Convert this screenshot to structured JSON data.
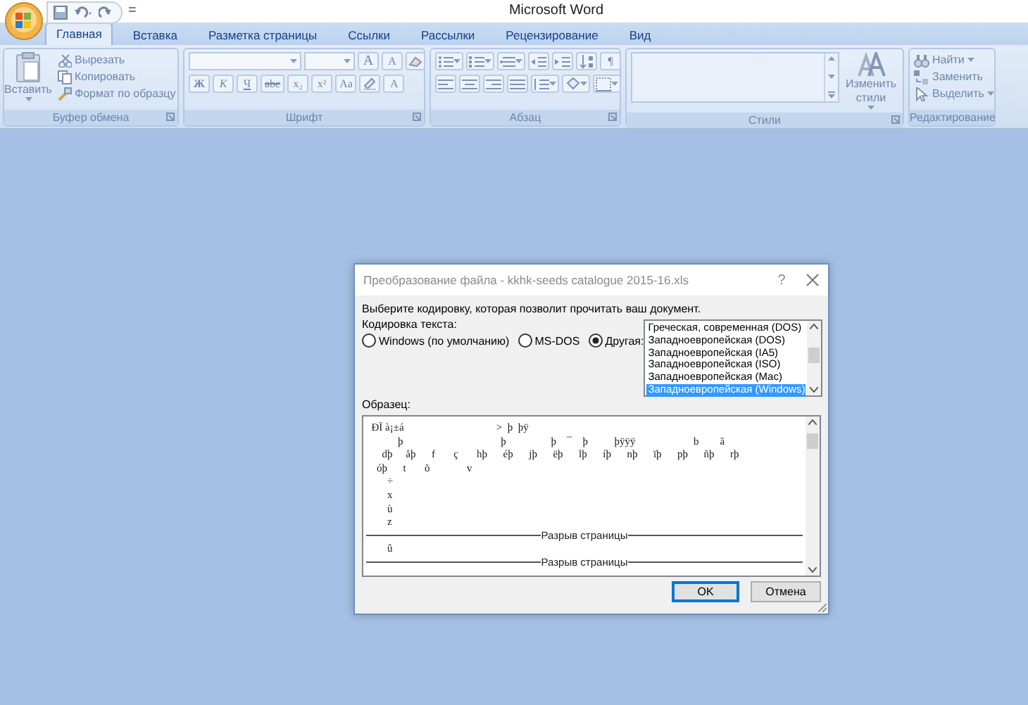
{
  "window": {
    "title": "Microsoft Word"
  },
  "quick_access": {
    "customize": "="
  },
  "tabs": [
    {
      "label": "Главная",
      "selected": true
    },
    {
      "label": "Вставка",
      "selected": false
    },
    {
      "label": "Разметка страницы",
      "selected": false
    },
    {
      "label": "Ссылки",
      "selected": false
    },
    {
      "label": "Рассылки",
      "selected": false
    },
    {
      "label": "Рецензирование",
      "selected": false
    },
    {
      "label": "Вид",
      "selected": false
    }
  ],
  "ribbon": {
    "disabled": true,
    "groups": [
      {
        "kind": "clipboard",
        "label": "Буфер обмена",
        "paste": "Вставить",
        "items": [
          "Вырезать",
          "Копировать",
          "Формат по образцу"
        ]
      },
      {
        "kind": "font",
        "label": "Шрифт",
        "row1": [
          "A",
          "A"
        ],
        "row2": [
          "Ж",
          "К",
          "Ч",
          "abe",
          "x₂",
          "x²",
          "Aa"
        ],
        "color_button": "A"
      },
      {
        "kind": "paragraph",
        "label": "Абзац",
        "pilcrow": "¶"
      },
      {
        "kind": "styles",
        "label": "Стили",
        "change": "Изменить стили"
      },
      {
        "kind": "editing",
        "label": "Редактирование",
        "items": [
          "Найти",
          "Заменить",
          "Выделить"
        ]
      }
    ]
  },
  "dialog": {
    "title": "Преобразование файла - kkhk-seeds catalogue 2015-16.xls",
    "help": "?",
    "prompt": "Выберите кодировку, которая позволит прочитать ваш документ.",
    "encoding_label": "Кодировка текста:",
    "radios": [
      {
        "label": "Windows (по умолчанию)",
        "selected": false
      },
      {
        "label": "MS-DOS",
        "selected": false
      },
      {
        "label": "Другая:",
        "selected": true
      }
    ],
    "encodings": [
      {
        "label": "Греческая, современная (DOS)",
        "selected": false
      },
      {
        "label": "Западноевропейская (DOS)",
        "selected": false
      },
      {
        "label": "Западноевропейская (IA5)",
        "selected": false
      },
      {
        "label": "Западноевропейская (ISO)",
        "selected": false
      },
      {
        "label": "Западноевропейская (Mac)",
        "selected": false
      },
      {
        "label": "Западноевропейская (Windows)",
        "selected": true
      }
    ],
    "sample_label": "Образец:",
    "sample_lines": [
      {
        "kind": "text",
        "text": "  ÐÏ à¡±á                                   >  þ  þÿ"
      },
      {
        "kind": "text",
        "text": "            þ                                     þ                 þ    ¯    þ          þÿÿÿ                      b        ã"
      },
      {
        "kind": "text",
        "text": "      dþ     åþ      f       ç       hþ      éþ      jþ      ëþ      lþ      íþ      nþ      ïþ      pþ      ñþ      rþ"
      },
      {
        "kind": "text",
        "text": "    óþ      t       õ              v"
      },
      {
        "kind": "text",
        "text": "        ÷"
      },
      {
        "kind": "text",
        "text": "        x"
      },
      {
        "kind": "text",
        "text": "        ù"
      },
      {
        "kind": "text",
        "text": "        z"
      },
      {
        "kind": "break",
        "text": "Разрыв страницы"
      },
      {
        "kind": "text",
        "text": "        û"
      },
      {
        "kind": "break",
        "text": "Разрыв страницы"
      }
    ],
    "buttons": [
      {
        "label": "OK",
        "default": true
      },
      {
        "label": "Отмена",
        "default": false
      }
    ]
  }
}
